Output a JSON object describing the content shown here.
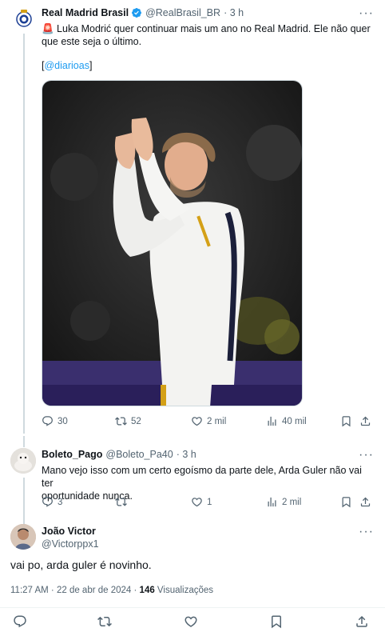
{
  "tweet1": {
    "author_name": "Real Madrid Brasil",
    "handle": "@RealBrasil_BR",
    "time": "· 3 h",
    "text_line1": "🚨 Luka Modrić quer continuar mais um ano no Real Madrid. Ele não quer",
    "text_line2": "que este seja o último.",
    "source_open": "[",
    "source_link": "@diarioas",
    "source_close": "]",
    "replies": "30",
    "reposts": "52",
    "likes": "2 mil",
    "views": "40 mil"
  },
  "tweet2": {
    "author_name": "Boleto_Pago",
    "handle": "@Boleto_Pa40",
    "time": "· 3 h",
    "text_line1": "Mano vejo isso com um certo egoísmo da parte dele, Arda Guler não vai ter",
    "text_line2": "oportunidade nunca.",
    "replies": "3",
    "likes": "1",
    "views": "2 mil"
  },
  "tweet3": {
    "author_name": "João Victor",
    "handle": "@Victorppx1",
    "text": "vai po, arda guler é novinho.",
    "timestamp": "11:27 AM · 22 de abr de 2024 · ",
    "views_count": "146",
    "views_label": " Visualizações"
  },
  "icons": [
    "reply-icon",
    "repost-icon",
    "like-icon",
    "views-icon",
    "bookmark-icon",
    "share-icon",
    "verified-icon",
    "more-icon"
  ],
  "colors": {
    "accent": "#1d9bf0",
    "muted": "#536471",
    "border": "#cfd9de"
  }
}
